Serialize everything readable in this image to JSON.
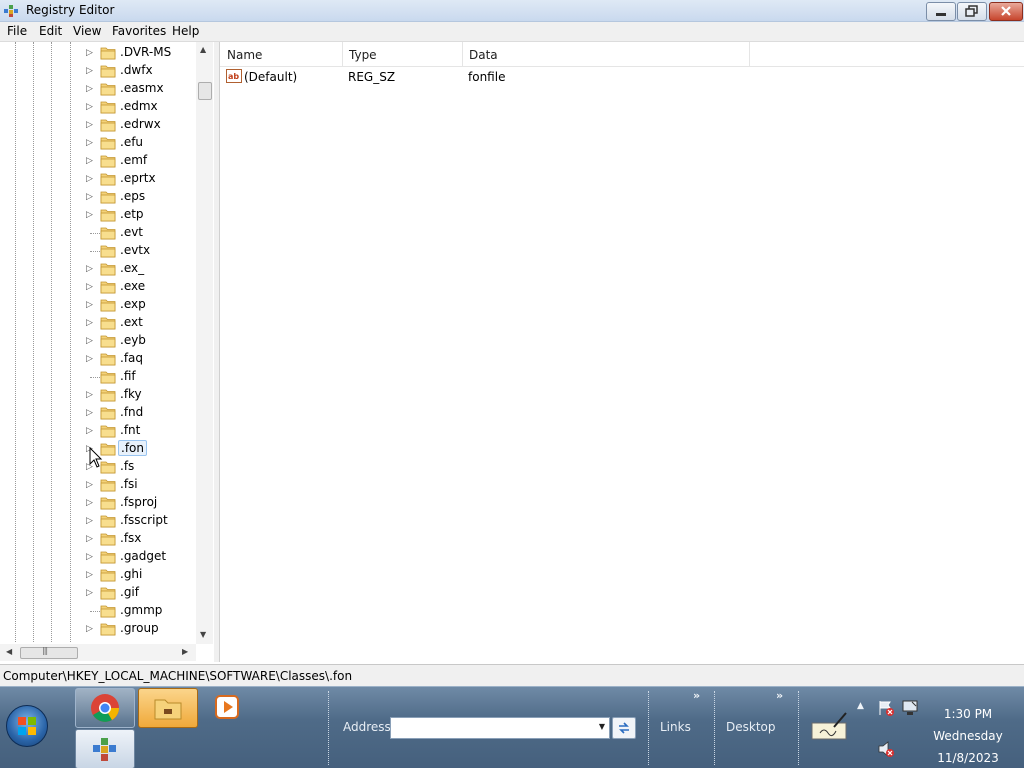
{
  "window": {
    "title": "Registry Editor",
    "buttons": [
      "minimize-button",
      "maximize-button",
      "close-button"
    ]
  },
  "menu": {
    "file": "File",
    "edit": "Edit",
    "view": "View",
    "favorites": "Favorites",
    "help": "Help"
  },
  "tree": {
    "items": [
      {
        "label": ".DVR-MS",
        "expandable": true
      },
      {
        "label": ".dwfx",
        "expandable": true
      },
      {
        "label": ".easmx",
        "expandable": true
      },
      {
        "label": ".edmx",
        "expandable": true
      },
      {
        "label": ".edrwx",
        "expandable": true
      },
      {
        "label": ".efu",
        "expandable": true
      },
      {
        "label": ".emf",
        "expandable": true
      },
      {
        "label": ".eprtx",
        "expandable": true
      },
      {
        "label": ".eps",
        "expandable": true
      },
      {
        "label": ".etp",
        "expandable": true
      },
      {
        "label": ".evt",
        "expandable": false
      },
      {
        "label": ".evtx",
        "expandable": false
      },
      {
        "label": ".ex_",
        "expandable": true
      },
      {
        "label": ".exe",
        "expandable": true
      },
      {
        "label": ".exp",
        "expandable": true
      },
      {
        "label": ".ext",
        "expandable": true
      },
      {
        "label": ".eyb",
        "expandable": true
      },
      {
        "label": ".faq",
        "expandable": true
      },
      {
        "label": ".fif",
        "expandable": false
      },
      {
        "label": ".fky",
        "expandable": true
      },
      {
        "label": ".fnd",
        "expandable": true
      },
      {
        "label": ".fnt",
        "expandable": true
      },
      {
        "label": ".fon",
        "expandable": true,
        "selected": true
      },
      {
        "label": ".fs",
        "expandable": true
      },
      {
        "label": ".fsi",
        "expandable": true
      },
      {
        "label": ".fsproj",
        "expandable": true
      },
      {
        "label": ".fsscript",
        "expandable": true
      },
      {
        "label": ".fsx",
        "expandable": true
      },
      {
        "label": ".gadget",
        "expandable": true
      },
      {
        "label": ".ghi",
        "expandable": true
      },
      {
        "label": ".gif",
        "expandable": true
      },
      {
        "label": ".gmmp",
        "expandable": false
      },
      {
        "label": ".group",
        "expandable": true
      }
    ]
  },
  "list": {
    "columns": {
      "name": "Name",
      "type": "Type",
      "data": "Data"
    },
    "rows": [
      {
        "name": "(Default)",
        "type": "REG_SZ",
        "data": "fonfile",
        "icon": "string-value-icon"
      }
    ]
  },
  "status": {
    "path": "Computer\\HKEY_LOCAL_MACHINE\\SOFTWARE\\Classes\\.fon"
  },
  "taskbar": {
    "address_label": "Address",
    "address_value": "",
    "links_label": "Links",
    "desktop_label": "Desktop",
    "time": "1:30 PM",
    "day": "Wednesday",
    "date": "11/8/2023"
  },
  "colors": {
    "taskbar": "#4f6b88",
    "selection": "#e8f1fb",
    "active_button": "#f0a93a"
  }
}
